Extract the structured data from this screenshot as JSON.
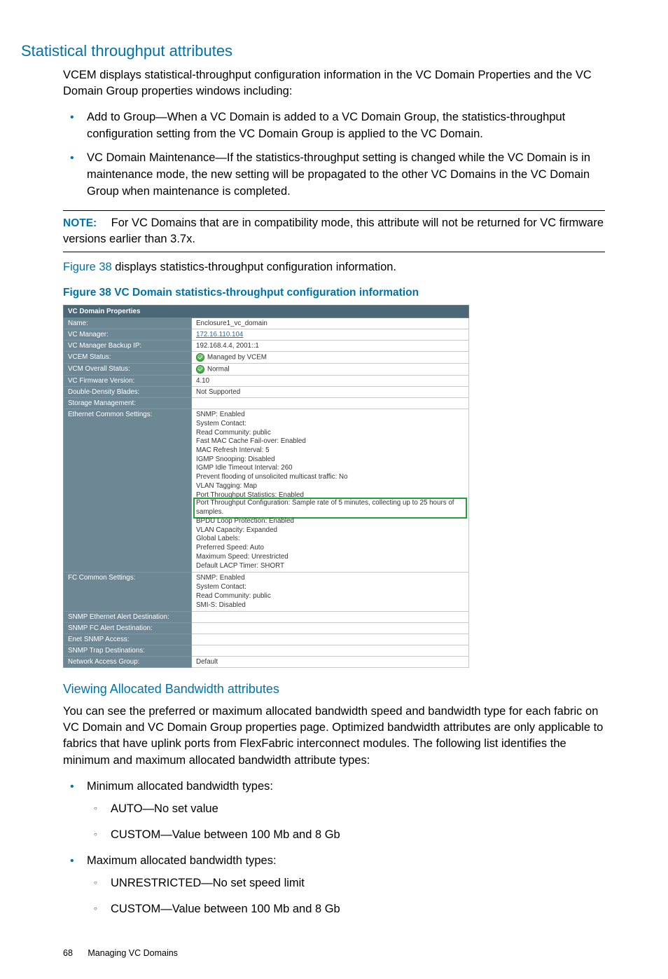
{
  "section_title": "Statistical throughput attributes",
  "intro_para": "VCEM displays statistical-throughput configuration information in the VC Domain Properties and the VC Domain Group properties windows including:",
  "intro_bullets": [
    "Add to Group—When a VC Domain is added to a VC Domain Group, the statistics-throughput configuration setting from the VC Domain Group is applied to the VC Domain.",
    "VC Domain Maintenance—If the statistics-throughput setting is changed while the VC Domain is in maintenance mode, the new setting will be propagated to the other VC Domains in the VC Domain Group when maintenance is completed."
  ],
  "note": {
    "label": "NOTE:",
    "text": "For VC Domains that are in compatibility mode, this attribute will not be returned for VC firmware versions earlier than 3.7x."
  },
  "fig_sentence_pre": "Figure 38",
  "fig_sentence_post": " displays statistics-throughput configuration information.",
  "figure_caption": "Figure 38 VC Domain statistics-throughput configuration information",
  "props": {
    "header": "VC Domain Properties",
    "rows": {
      "name_label": "Name:",
      "name_value": "Enclosure1_vc_domain",
      "mgr_label": "VC Manager:",
      "mgr_value": "172.16.110.104",
      "bkp_label": "VC Manager Backup IP:",
      "bkp_value": "192.168.4.4, 2001::1",
      "vcem_label": "VCEM Status:",
      "vcem_value": "Managed by VCEM",
      "vcm_label": "VCM Overall Status:",
      "vcm_value": "Normal",
      "fw_label": "VC Firmware Version:",
      "fw_value": "4.10",
      "dd_label": "Double-Density Blades:",
      "dd_value": "Not Supported",
      "stor_label": "Storage Management:",
      "stor_value": "",
      "eth_label": "Ethernet Common Settings:",
      "eth_lines": [
        "SNMP: Enabled",
        "System Contact:",
        "Read Community: public",
        "Fast MAC Cache Fail-over: Enabled",
        "MAC Refresh Interval: 5",
        "IGMP Snooping: Disabled",
        "IGMP Idle Timeout Interval: 260",
        "Prevent flooding of unsolicited multicast traffic: No",
        "VLAN Tagging: Map",
        "Port Throughput Statistics: Enabled"
      ],
      "eth_highlight": "Port Throughput Configuration: Sample rate of 5 minutes, collecting up to 25 hours of samples.",
      "eth_lines_after": [
        "BPDU Loop Protection: Enabled",
        "VLAN Capacity: Expanded",
        "Global Labels:",
        "Preferred Speed: Auto",
        "Maximum Speed: Unrestricted",
        "Default LACP Timer: SHORT"
      ],
      "fc_label": "FC Common Settings:",
      "fc_lines": [
        "SNMP: Enabled",
        "System Contact:",
        "Read Community: public",
        "SMI-S: Disabled"
      ],
      "snmp_eth_label": "SNMP Ethernet Alert Destination:",
      "snmp_eth_value": "",
      "snmp_fc_label": "SNMP FC Alert Destination:",
      "snmp_fc_value": "",
      "enet_label": "Enet SNMP Access:",
      "enet_value": "",
      "trap_label": "SNMP Trap Destinations:",
      "trap_value": "",
      "net_label": "Network Access Group:",
      "net_value": "Default"
    }
  },
  "subsection_title": "Viewing Allocated Bandwidth attributes",
  "sub_para": "You can see the preferred or maximum allocated bandwidth speed and bandwidth type for each fabric on VC Domain and VC Domain Group properties page. Optimized bandwidth attributes are only applicable to fabrics that have uplink ports from FlexFabric interconnect modules. The following list identifies the minimum and maximum allocated bandwidth attribute types:",
  "min_heading": "Minimum allocated bandwidth types:",
  "min_items": [
    "AUTO—No set value",
    "CUSTOM—Value between 100 Mb and 8 Gb"
  ],
  "max_heading": "Maximum allocated bandwidth types:",
  "max_items": [
    "UNRESTRICTED—No set speed limit",
    "CUSTOM—Value between 100 Mb and 8 Gb"
  ],
  "footer": {
    "page": "68",
    "title": "Managing VC Domains"
  }
}
